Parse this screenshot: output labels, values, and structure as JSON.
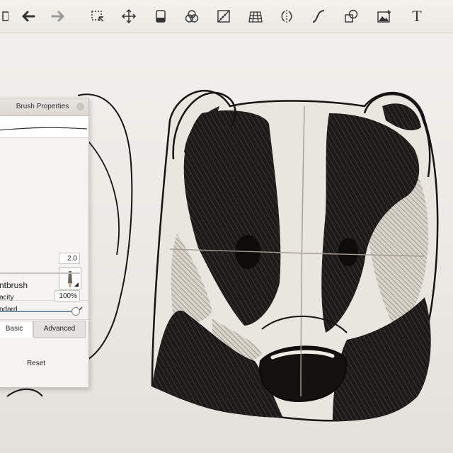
{
  "toolbar": {
    "tools": [
      {
        "icon": "undo-icon"
      },
      {
        "icon": "redo-icon"
      },
      {
        "icon": "select-icon"
      },
      {
        "icon": "transform-icon"
      },
      {
        "icon": "layers-icon"
      },
      {
        "icon": "color-icon"
      },
      {
        "icon": "ruler-icon"
      },
      {
        "icon": "perspective-grid-icon"
      },
      {
        "icon": "symmetry-icon"
      },
      {
        "icon": "curve-icon"
      },
      {
        "icon": "shapes-icon"
      },
      {
        "icon": "image-icon"
      },
      {
        "icon": "text-icon",
        "glyph": "T"
      }
    ]
  },
  "brush_panel": {
    "title": "Brush Properties",
    "brush_name": "ntbrush",
    "preset": "ndard",
    "tabs": {
      "basic": "Basic",
      "advanced": "Advanced"
    },
    "size": {
      "value": "2.0",
      "level": 0.05
    },
    "opacity": {
      "label": "acity",
      "value": "100%",
      "level": 1.0
    },
    "reset_label": "Reset"
  }
}
